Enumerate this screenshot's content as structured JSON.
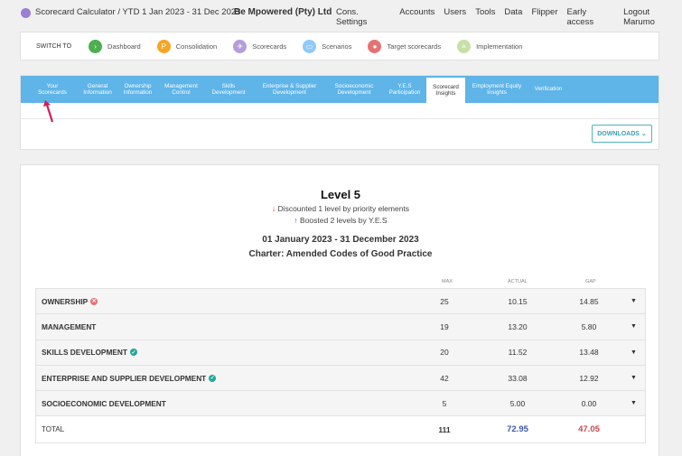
{
  "topbar": {
    "crumb": "Scorecard Calculator / YTD 1 Jan 2023 - 31 Dec 2023",
    "company": "Be Mpowered (Pty) Ltd",
    "nav": [
      "Cons. Settings",
      "Accounts",
      "Users",
      "Tools",
      "Data",
      "Flipper",
      "Early access",
      "Logout Marumo"
    ]
  },
  "switch": {
    "label": "SWITCH TO",
    "items": [
      {
        "label": "Dashboard",
        "color": "#4caf50",
        "glyph": "›"
      },
      {
        "label": "Consolidation",
        "color": "#f5a623",
        "glyph": "P"
      },
      {
        "label": "Scorecards",
        "color": "#b39ddb",
        "glyph": "✈"
      },
      {
        "label": "Scenarios",
        "color": "#90caf9",
        "glyph": "▭"
      },
      {
        "label": "Target scorecards",
        "color": "#e57373",
        "glyph": "●"
      },
      {
        "label": "Implementation",
        "color": "#c5e1a5",
        "glyph": "≡"
      }
    ]
  },
  "tabs": [
    {
      "l1": "Your",
      "l2": "Scorecards",
      "w": 58
    },
    {
      "l1": "General",
      "l2": "Information",
      "w": 42
    },
    {
      "l1": "Ownership",
      "l2": "Information",
      "w": 47
    },
    {
      "l1": "Management",
      "l2": "Control",
      "w": 49
    },
    {
      "l1": "Skills",
      "l2": "Development",
      "w": 56
    },
    {
      "l1": "Enterprise & Supplier",
      "l2": "Development",
      "w": 79
    },
    {
      "l1": "Socioeconomic",
      "l2": "Development",
      "w": 64
    },
    {
      "l1": "Y.E.S",
      "l2": "Participation",
      "w": 48
    },
    {
      "l1": "Scorecard",
      "l2": "Insights",
      "w": 43,
      "active": true
    },
    {
      "l1": "Employment Equity",
      "l2": "Insights",
      "w": 70
    },
    {
      "l1": "Verification",
      "l2": "",
      "w": 44
    }
  ],
  "downloads": "DOWNLOADS",
  "report": {
    "level": "Level 5",
    "discount": "Discounted 1 level by priority elements",
    "boost": "Boosted 2 levels by Y.E.S",
    "dates": "01 January 2023 - 31 December 2023",
    "charter": "Charter: Amended Codes of Good Practice"
  },
  "columns": {
    "max": "MAX",
    "actual": "ACTUAL",
    "gap": "GAP"
  },
  "rows": [
    {
      "name": "OWNERSHIP",
      "badge": "fail",
      "max": "25",
      "actual": "10.15",
      "gap": "14.85"
    },
    {
      "name": "MANAGEMENT",
      "badge": "",
      "max": "19",
      "actual": "13.20",
      "gap": "5.80"
    },
    {
      "name": "SKILLS DEVELOPMENT",
      "badge": "ok",
      "max": "20",
      "actual": "11.52",
      "gap": "13.48"
    },
    {
      "name": "ENTERPRISE AND SUPPLIER DEVELOPMENT",
      "badge": "ok",
      "max": "42",
      "actual": "33.08",
      "gap": "12.92"
    },
    {
      "name": "SOCIOECONOMIC DEVELOPMENT",
      "badge": "",
      "max": "5",
      "actual": "5.00",
      "gap": "0.00"
    }
  ],
  "total": {
    "name": "TOTAL",
    "max": "111",
    "actual": "72.95",
    "gap": "47.05"
  }
}
